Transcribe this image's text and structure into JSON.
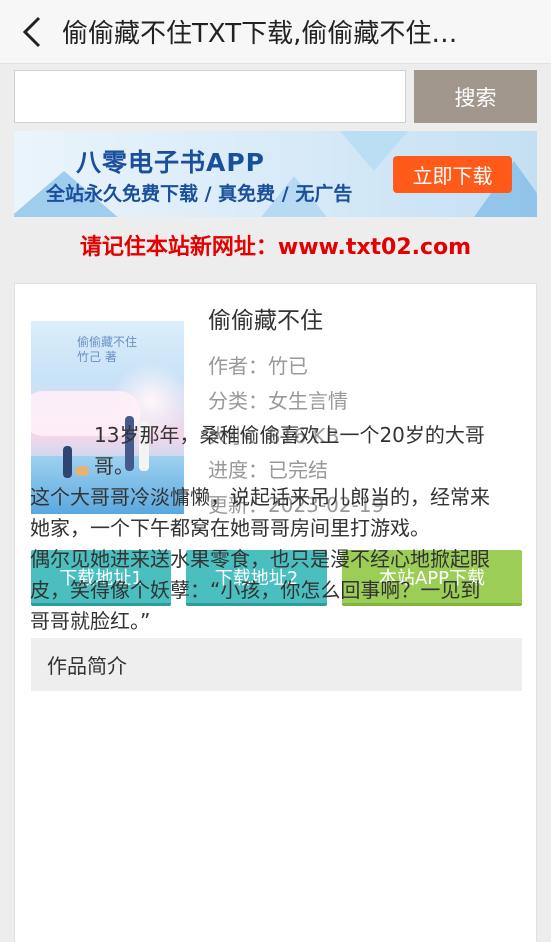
{
  "header": {
    "title": "偷偷藏不住TXT下载,偷偷藏不住全集下载"
  },
  "search": {
    "placeholder": "",
    "value": "",
    "button_label": "搜索"
  },
  "banner": {
    "title": "八零电子书APP",
    "subtitle": "全站永久免费下载 / 真免费 / 无广告",
    "button_label": "立即下载"
  },
  "notice": "请记住本站新网址：www.txt02.com",
  "book": {
    "title": "偷偷藏不住",
    "cover_text": [
      "偷偷藏不住",
      "竹己 著"
    ],
    "meta": [
      {
        "label": "作者：",
        "value": "竹已"
      },
      {
        "label": "分类：",
        "value": "女生言情"
      },
      {
        "label": "大小：",
        "value": "816 KB"
      },
      {
        "label": "进度：",
        "value": "已完结"
      },
      {
        "label": "更新：",
        "value": "2023-02-19"
      }
    ]
  },
  "buttons": {
    "download1": "下载地址1",
    "download2": "下载地址2",
    "app_download": "本站APP下载"
  },
  "intro": {
    "heading": "作品简介",
    "paragraphs": [
      "13岁那年，桑稚偷偷喜欢上一个20岁的大哥哥。",
      "这个大哥哥冷淡慵懒，说起话来吊儿郎当的，经常来她家，一个下午都窝在她哥哥房间里打游戏。",
      "偶尔见她进来送水果零食，也只是漫不经心地掀起眼皮，笑得像个妖孽：“小孩，你怎么回事啊？一见到哥哥就脸红。”"
    ]
  },
  "colors": {
    "search_button": "#a1978d",
    "banner_button": "#ff5a1a",
    "notice": "#e30000",
    "teal_button": "#4bbfbf",
    "green_button": "#9ccd57"
  }
}
